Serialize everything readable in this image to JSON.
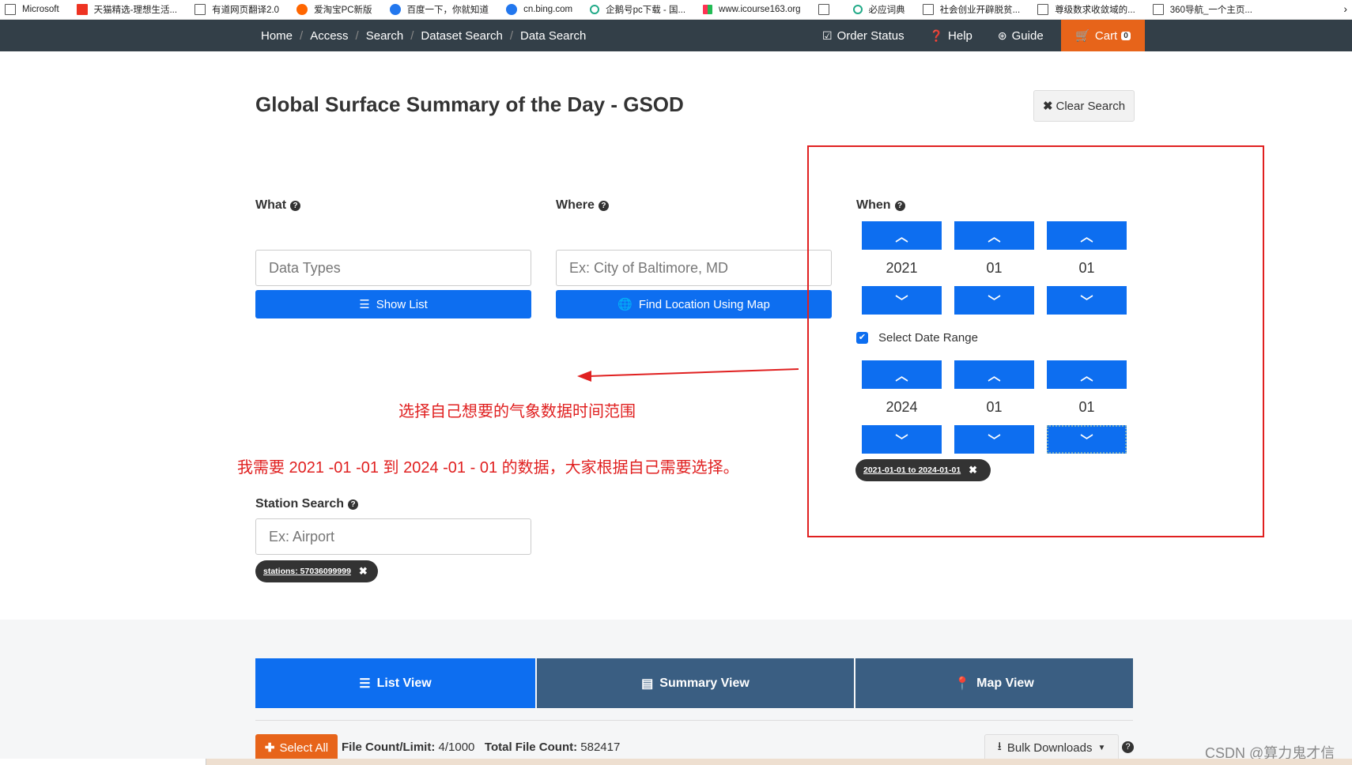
{
  "bookmarks": [
    {
      "label": "Microsoft",
      "icon": "page-icon"
    },
    {
      "label": "天猫精选-理想生活...",
      "icon": "tmall-icon"
    },
    {
      "label": "有道网页翻译2.0",
      "icon": "page-icon"
    },
    {
      "label": "爱淘宝PC新版",
      "icon": "taobao-icon"
    },
    {
      "label": "百度一下，你就知道",
      "icon": "baidu-icon"
    },
    {
      "label": "cn.bing.com",
      "icon": "bing-icon"
    },
    {
      "label": "企鹅号pc下载 - 国...",
      "icon": "search-icon"
    },
    {
      "label": "www.icourse163.org",
      "icon": "icourse-icon"
    },
    {
      "label": "",
      "icon": "page-icon"
    },
    {
      "label": "必应词典",
      "icon": "search-icon"
    },
    {
      "label": "社会创业开辟脱贫...",
      "icon": "page-icon"
    },
    {
      "label": "尊级数求收敛域的...",
      "icon": "page-icon"
    },
    {
      "label": "360导航_一个主页...",
      "icon": "page-icon"
    }
  ],
  "nav": {
    "breadcrumbs": [
      "Home",
      "Access",
      "Search",
      "Dataset Search",
      "Data Search"
    ],
    "order_status": "Order Status",
    "help": "Help",
    "guide": "Guide",
    "cart": "Cart",
    "cart_count": "0",
    "accent_color": "#e7641a"
  },
  "page_title": "Global Surface Summary of the Day - GSOD",
  "clear_search": "Clear Search",
  "what": {
    "label": "What",
    "placeholder": "Data Types",
    "button": "Show List"
  },
  "where": {
    "label": "Where",
    "placeholder": "Ex: City of Baltimore, MD",
    "button": "Find Location Using Map"
  },
  "when": {
    "label": "When",
    "start": {
      "year": "2021",
      "month": "01",
      "day": "01"
    },
    "range_label": "Select Date Range",
    "range_checked": true,
    "end": {
      "year": "2024",
      "month": "01",
      "day": "01"
    },
    "range_pill": "2021-01-01 to 2024-01-01"
  },
  "station": {
    "label": "Station Search",
    "placeholder": "Ex: Airport",
    "pill": "stations: 57036099999"
  },
  "annotations": {
    "arrow_note": "选择自己想要的气象数据时间范围",
    "range_note": "我需要 2021 -01 -01  到  2024 -01 - 01 的数据，大家根据自己需要选择。"
  },
  "tabs": [
    {
      "label": "List View",
      "active": true
    },
    {
      "label": "Summary View",
      "active": false
    },
    {
      "label": "Map View",
      "active": false
    }
  ],
  "results": {
    "select_all": "Select All",
    "file_count_label": "File Count/Limit:",
    "file_count_value": "4/1000",
    "total_label": "Total File Count:",
    "total_value": "582417",
    "bulk": "Bulk Downloads"
  },
  "watermark": "CSDN @算力鬼才信"
}
